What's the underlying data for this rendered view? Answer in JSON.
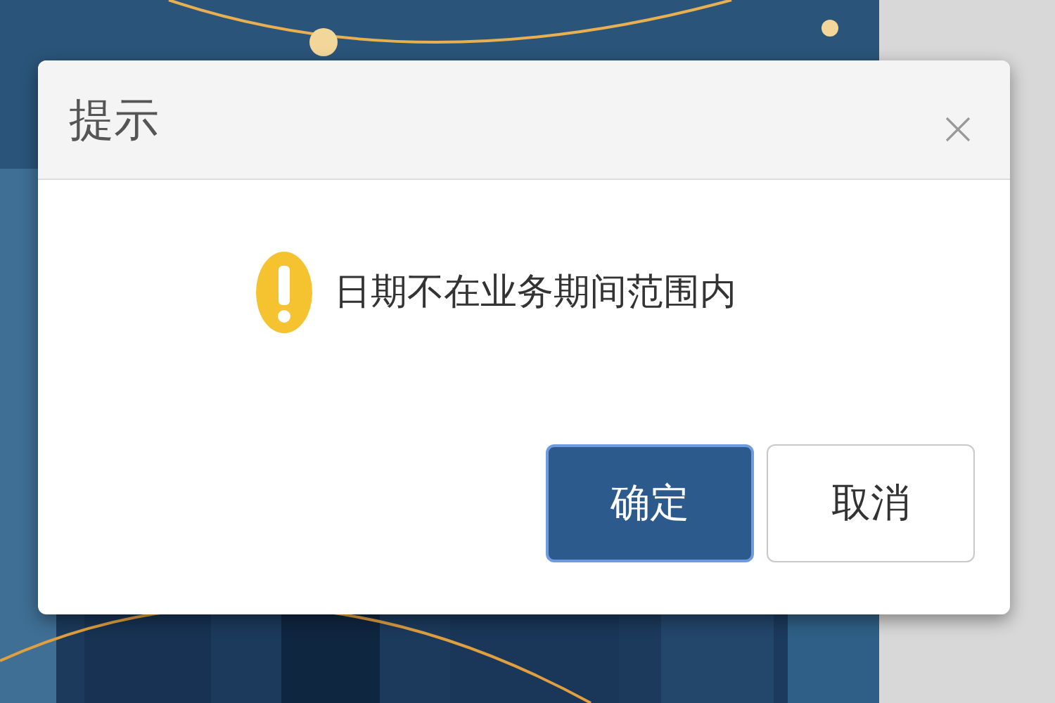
{
  "dialog": {
    "title": "提示",
    "message": "日期不在业务期间范围内",
    "buttons": [
      {
        "label": "确定",
        "kind": "primary"
      },
      {
        "label": "取消",
        "kind": "secondary"
      }
    ]
  }
}
